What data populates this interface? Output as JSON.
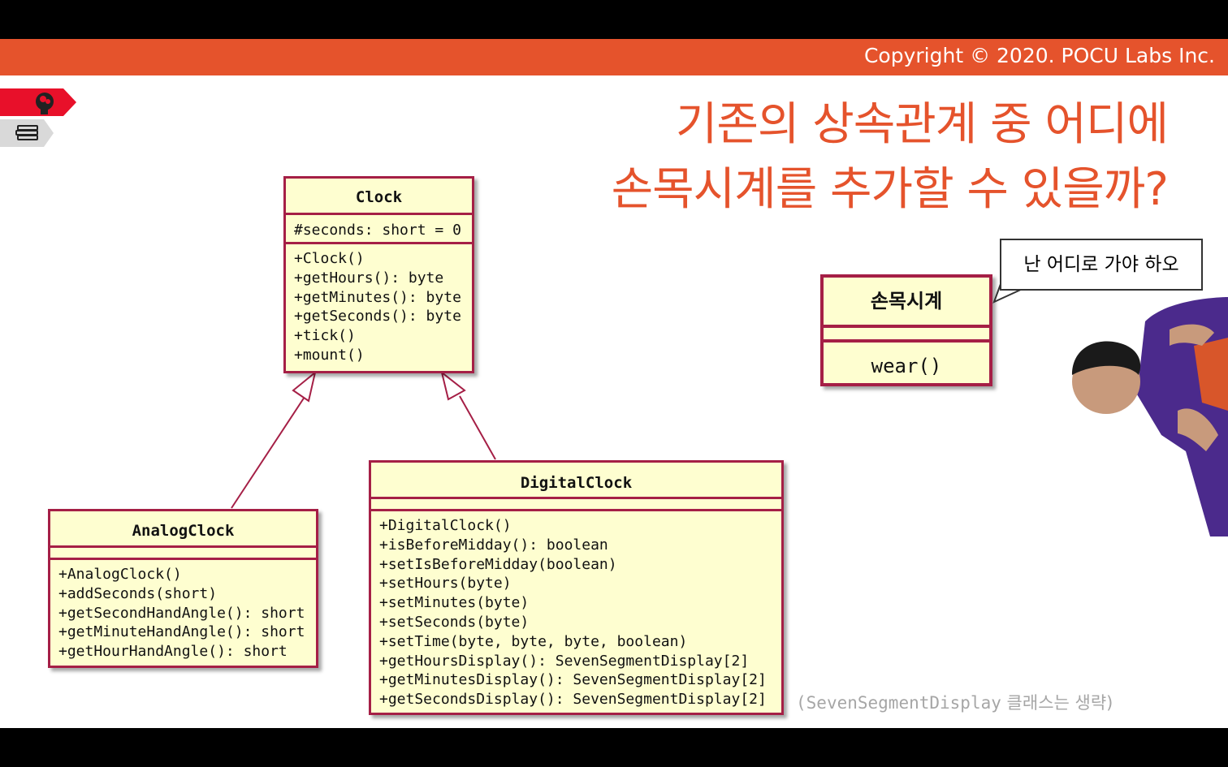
{
  "header": {
    "copyright": "Copyright © 2020. POCU Labs Inc."
  },
  "title": {
    "line1": "기존의 상속관계 중 어디에",
    "line2": "손목시계를 추가할 수 있을까?"
  },
  "diagram": {
    "clock": {
      "name": "Clock",
      "attributes": "#seconds: short = 0",
      "methods": "+Clock()\n+getHours(): byte\n+getMinutes(): byte\n+getSeconds(): byte\n+tick()\n+mount()"
    },
    "analog_clock": {
      "name": "AnalogClock",
      "methods": "+AnalogClock()\n+addSeconds(short)\n+getSecondHandAngle(): short\n+getMinuteHandAngle(): short\n+getHourHandAngle(): short"
    },
    "digital_clock": {
      "name": "DigitalClock",
      "methods": "+DigitalClock()\n+isBeforeMidday(): boolean\n+setIsBeforeMidday(boolean)\n+setHours(byte)\n+setMinutes(byte)\n+setSeconds(byte)\n+setTime(byte, byte, byte, boolean)\n+getHoursDisplay(): SevenSegmentDisplay[2]\n+getMinutesDisplay(): SevenSegmentDisplay[2]\n+getSecondsDisplay(): SevenSegmentDisplay[2]"
    },
    "wristwatch": {
      "name": "손목시계",
      "methods": "wear()"
    }
  },
  "speech_bubble": "난 어디로 가야 하오",
  "note": {
    "open": "(",
    "class_name": "SevenSegmentDisplay",
    "suffix": " 클래스는 생략)"
  },
  "colors": {
    "accent": "#e5532c",
    "uml_border": "#a51f46",
    "uml_fill": "#fefed0"
  },
  "icons": [
    "brain-icon",
    "books-icon"
  ]
}
